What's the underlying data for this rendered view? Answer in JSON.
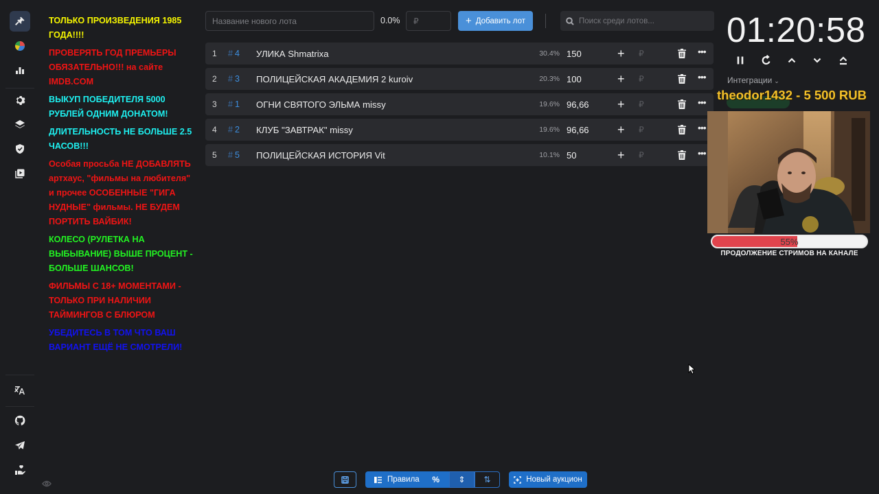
{
  "rules": [
    {
      "text": "ТОЛЬКО ПРОИЗВЕДЕНИЯ 1985 ГОДА!!!!",
      "color": "#f7f700"
    },
    {
      "text": "ПРОВЕРЯТЬ ГОД ПРЕМЬЕРЫ ОБЯЗАТЕЛЬНО!!! на сайте IMDB.COM",
      "color": "#f01414"
    },
    {
      "text": "ВЫКУП ПОБЕДИТЕЛЯ 5000 РУБЛЕЙ ОДНИМ ДОНАТОМ!",
      "color": "#1ef0f0"
    },
    {
      "text": "ДЛИТЕЛЬНОСТЬ НЕ БОЛЬШЕ 2.5 ЧАСОВ!!!",
      "color": "#1ef0f0"
    },
    {
      "text": "Особая просьба НЕ ДОБАВЛЯТЬ артхаус, \"фильмы на любителя\" и прочее ОСОБЕННЫЕ \"ГИГА НУДНЫЕ\" фильмы. НЕ БУДЕМ ПОРТИТЬ ВАЙБИК!",
      "color": "#f01414"
    },
    {
      "text": "КОЛЕСО (РУЛЕТКА НА ВЫБЫВАНИЕ) ВЫШЕ ПРОЦЕНТ - БОЛЬШЕ ШАНСОВ!",
      "color": "#22f322"
    },
    {
      "text": "ФИЛЬМЫ С 18+ МОМЕНТАМИ - ТОЛЬКО ПРИ НАЛИЧИИ ТАЙМИНГОВ С БЛЮРОМ",
      "color": "#f01414"
    },
    {
      "text": "УБЕДИТЕСЬ В ТОМ ЧТО ВАШ ВАРИАНТ ЕЩЁ НЕ СМОТРЕЛИ!",
      "color": "#1212f0"
    }
  ],
  "topbar": {
    "lot_name_placeholder": "Название нового лота",
    "percent": "0.0%",
    "amount_placeholder": "₽",
    "add_label": "Добавить лот",
    "search_placeholder": "Поиск среди лотов..."
  },
  "lots": [
    {
      "index": "1",
      "fast_id": "4",
      "name": "УЛИКА Shmatrixa",
      "share": "30.4%",
      "amount": "150",
      "plus": "+",
      "currency": "₽",
      "more": "•••"
    },
    {
      "index": "2",
      "fast_id": "3",
      "name": "ПОЛИЦЕЙСКАЯ АКАДЕМИЯ 2 kuroiv",
      "share": "20.3%",
      "amount": "100",
      "plus": "+",
      "currency": "₽",
      "more": "•••"
    },
    {
      "index": "3",
      "fast_id": "1",
      "name": "ОГНИ СВЯТОГО ЭЛЬМА missy",
      "share": "19.6%",
      "amount": "96,66",
      "plus": "+",
      "currency": "₽",
      "more": "•••"
    },
    {
      "index": "4",
      "fast_id": "2",
      "name": "КЛУБ \"ЗАВТРАК\" missy",
      "share": "19.6%",
      "amount": "96,66",
      "plus": "+",
      "currency": "₽",
      "more": "•••"
    },
    {
      "index": "5",
      "fast_id": "5",
      "name": "ПОЛИЦЕЙСКАЯ ИСТОРИЯ Vit",
      "share": "10.1%",
      "amount": "50",
      "plus": "+",
      "currency": "₽",
      "more": "•••"
    }
  ],
  "timer": {
    "value": "01:20:58"
  },
  "integrations": {
    "label": "Интеграции",
    "chevron": "⌄"
  },
  "donation": {
    "text": "theodor1432 - 5 500 RUB"
  },
  "goal": {
    "progress_pct": 55,
    "label": "55%",
    "title": "ПРОДОЛЖЕНИЕ СТРИМОВ НА КАНАЛЕ"
  },
  "bottom": {
    "rules_label": "Правила",
    "percent_label": "%",
    "new_auction_label": "Новый аукцион",
    "align_label": "⇕",
    "sort_label": "⇅"
  },
  "icons": {
    "hash": "#",
    "plus": "+"
  },
  "colors": {
    "accent": "#4a90d9",
    "lot_bg": "#2a2b2f",
    "bg": "#1c1d20",
    "goal_fill": "#e0444d",
    "donation": "#f3c02a"
  }
}
